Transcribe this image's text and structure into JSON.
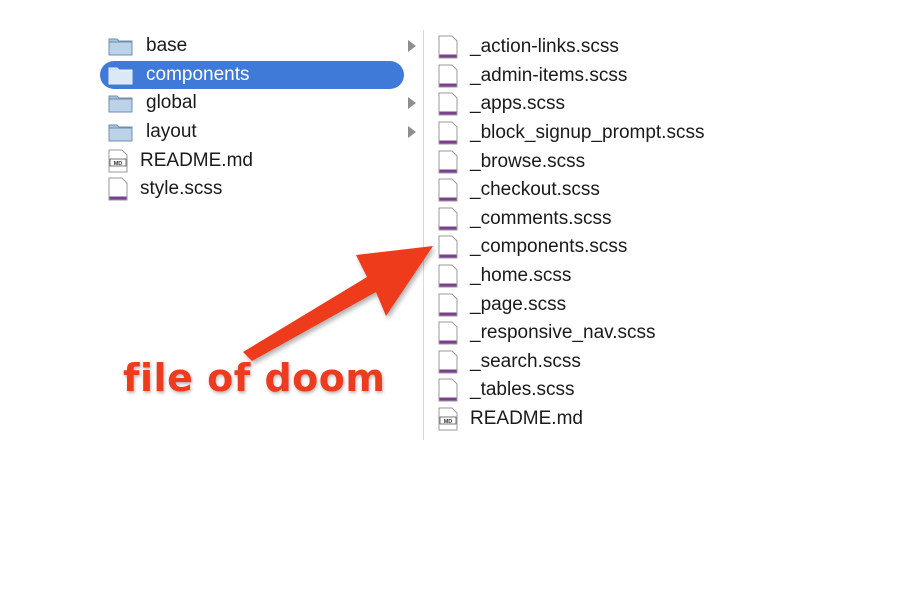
{
  "column1": {
    "items": [
      {
        "label": "base",
        "type": "folder"
      },
      {
        "label": "components",
        "type": "folder",
        "selected": true
      },
      {
        "label": "global",
        "type": "folder"
      },
      {
        "label": "layout",
        "type": "folder"
      },
      {
        "label": "README.md",
        "type": "md"
      },
      {
        "label": "style.scss",
        "type": "file"
      }
    ]
  },
  "column2": {
    "items": [
      {
        "label": "_action-links.scss",
        "type": "file"
      },
      {
        "label": "_admin-items.scss",
        "type": "file"
      },
      {
        "label": "_apps.scss",
        "type": "file"
      },
      {
        "label": "_block_signup_prompt.scss",
        "type": "file"
      },
      {
        "label": "_browse.scss",
        "type": "file"
      },
      {
        "label": "_checkout.scss",
        "type": "file"
      },
      {
        "label": "_comments.scss",
        "type": "file"
      },
      {
        "label": "_components.scss",
        "type": "file"
      },
      {
        "label": "_home.scss",
        "type": "file"
      },
      {
        "label": "_page.scss",
        "type": "file"
      },
      {
        "label": "_responsive_nav.scss",
        "type": "file"
      },
      {
        "label": "_search.scss",
        "type": "file"
      },
      {
        "label": "_tables.scss",
        "type": "file"
      },
      {
        "label": "README.md",
        "type": "md"
      }
    ]
  },
  "annotation": {
    "text": "file of doom",
    "color": "#ee3a1d"
  },
  "colors": {
    "selection": "#3f7ad8",
    "folder": "#8fb2d4",
    "scss_stripe": "#7b3f8f"
  }
}
